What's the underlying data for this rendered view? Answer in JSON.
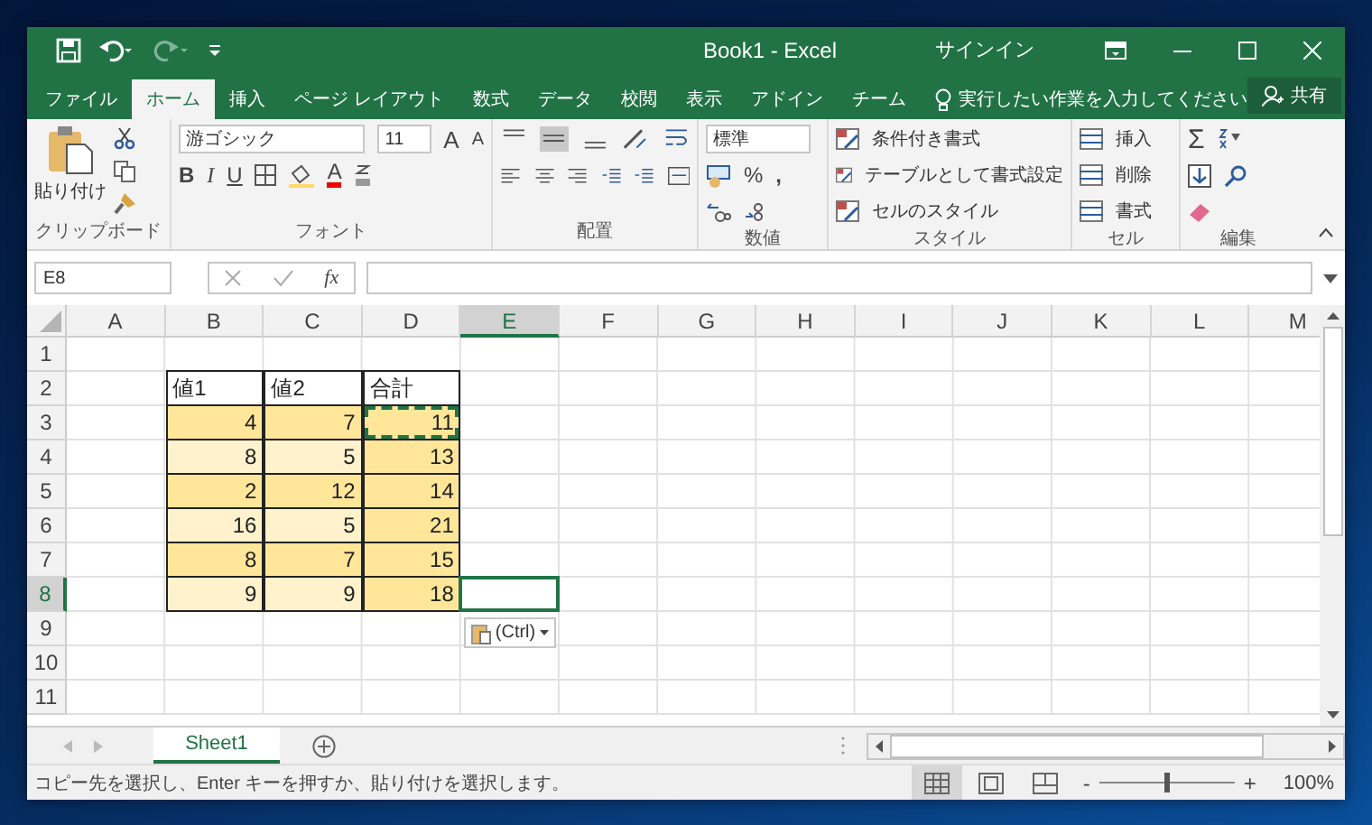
{
  "title_bar": {
    "title": "Book1 - Excel",
    "sign_in": "サインイン"
  },
  "ribbon_tabs": [
    {
      "label": "ファイル",
      "selected": false
    },
    {
      "label": "ホーム",
      "selected": true
    },
    {
      "label": "挿入",
      "selected": false
    },
    {
      "label": "ページ レイアウト",
      "selected": false
    },
    {
      "label": "数式",
      "selected": false
    },
    {
      "label": "データ",
      "selected": false
    },
    {
      "label": "校閲",
      "selected": false
    },
    {
      "label": "表示",
      "selected": false
    },
    {
      "label": "アドイン",
      "selected": false
    },
    {
      "label": "チーム",
      "selected": false
    }
  ],
  "tell_me": "実行したい作業を入力してください",
  "share": "共有",
  "ribbon": {
    "clipboard": {
      "paste": "貼り付け",
      "label": "クリップボード"
    },
    "font": {
      "name": "游ゴシック",
      "size": "11",
      "grow": "A",
      "shrink": "A",
      "bold": "B",
      "italic": "I",
      "underline": "U",
      "font_color": "A",
      "label": "フォント"
    },
    "alignment": {
      "label": "配置"
    },
    "number": {
      "format": "標準",
      "percent": "%",
      "comma": ",",
      "label": "数値"
    },
    "styles": {
      "items": [
        "条件付き書式",
        "テーブルとして書式設定",
        "セルのスタイル"
      ],
      "label": "スタイル"
    },
    "cells": {
      "items": [
        "挿入",
        "削除",
        "書式"
      ],
      "label": "セル"
    },
    "editing": {
      "sum": "Σ",
      "label": "編集"
    }
  },
  "formula_bar": {
    "name_box": "E8",
    "fx": "fx"
  },
  "sheet": {
    "columns": [
      {
        "label": "A",
        "selected": false
      },
      {
        "label": "B",
        "selected": false
      },
      {
        "label": "C",
        "selected": false
      },
      {
        "label": "D",
        "selected": false
      },
      {
        "label": "E",
        "selected": true
      },
      {
        "label": "F",
        "selected": false
      },
      {
        "label": "G",
        "selected": false
      },
      {
        "label": "H",
        "selected": false
      },
      {
        "label": "I",
        "selected": false
      },
      {
        "label": "J",
        "selected": false
      },
      {
        "label": "K",
        "selected": false
      },
      {
        "label": "L",
        "selected": false
      },
      {
        "label": "M",
        "selected": false
      }
    ],
    "rows": [
      {
        "label": "1",
        "selected": false,
        "cells": []
      },
      {
        "label": "2",
        "selected": false,
        "cells": [
          {
            "text": "値1",
            "color": "#ffffff",
            "copied": false
          },
          {
            "text": "値2",
            "color": "#ffffff",
            "copied": false
          },
          {
            "text": "合計",
            "color": "#ffffff",
            "copied": false
          }
        ]
      },
      {
        "label": "3",
        "selected": false,
        "cells": [
          {
            "text": "4",
            "color": "#ffe699",
            "copied": false
          },
          {
            "text": "7",
            "color": "#ffe699",
            "copied": false
          },
          {
            "text": "11",
            "color": "#ffe699",
            "copied": true
          }
        ]
      },
      {
        "label": "4",
        "selected": false,
        "cells": [
          {
            "text": "8",
            "color": "#fff2cc",
            "copied": false
          },
          {
            "text": "5",
            "color": "#fff2cc",
            "copied": false
          },
          {
            "text": "13",
            "color": "#ffe699",
            "copied": false
          }
        ]
      },
      {
        "label": "5",
        "selected": false,
        "cells": [
          {
            "text": "2",
            "color": "#ffe699",
            "copied": false
          },
          {
            "text": "12",
            "color": "#ffe699",
            "copied": false
          },
          {
            "text": "14",
            "color": "#ffe699",
            "copied": false
          }
        ]
      },
      {
        "label": "6",
        "selected": false,
        "cells": [
          {
            "text": "16",
            "color": "#fff2cc",
            "copied": false
          },
          {
            "text": "5",
            "color": "#fff2cc",
            "copied": false
          },
          {
            "text": "21",
            "color": "#ffe699",
            "copied": false
          }
        ]
      },
      {
        "label": "7",
        "selected": false,
        "cells": [
          {
            "text": "8",
            "color": "#ffe699",
            "copied": false
          },
          {
            "text": "7",
            "color": "#ffe699",
            "copied": false
          },
          {
            "text": "15",
            "color": "#ffe699",
            "copied": false
          }
        ]
      },
      {
        "label": "8",
        "selected": true,
        "cells": [
          {
            "text": "9",
            "color": "#fff2cc",
            "copied": false
          },
          {
            "text": "9",
            "color": "#fff2cc",
            "copied": false
          },
          {
            "text": "18",
            "color": "#ffe699",
            "copied": false
          }
        ]
      },
      {
        "label": "9",
        "selected": false,
        "cells": []
      },
      {
        "label": "10",
        "selected": false,
        "cells": []
      },
      {
        "label": "11",
        "selected": false,
        "cells": []
      }
    ],
    "paste_options": "(Ctrl)"
  },
  "sheet_tabs": [
    {
      "label": "Sheet1",
      "selected": true
    }
  ],
  "status_bar": {
    "message": "コピー先を選択し、Enter キーを押すか、貼り付けを選択します。",
    "views": [
      {
        "kind": "normal",
        "selected": true
      },
      {
        "kind": "layout",
        "selected": false
      },
      {
        "kind": "pagebreak",
        "selected": false
      }
    ],
    "zoom_out": "-",
    "zoom_in": "+",
    "zoom": "100%",
    "level": 0.5
  }
}
